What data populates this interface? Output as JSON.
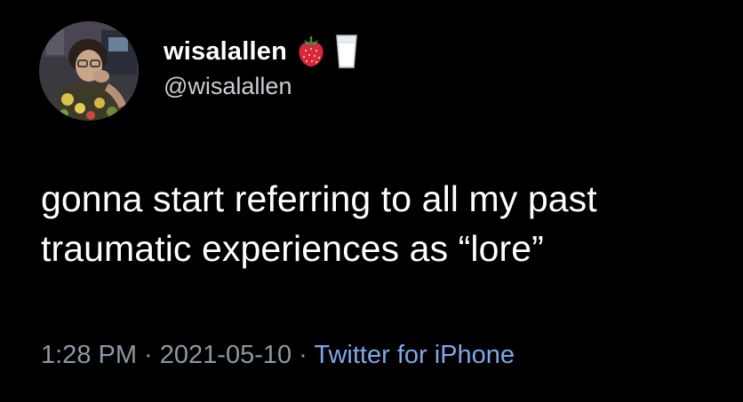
{
  "tweet": {
    "author": {
      "display_name": "wisalallen",
      "handle": "@wisalallen",
      "emojis": [
        "strawberry-emoji",
        "milk-glass-emoji"
      ]
    },
    "text_lines": [
      "gonna start referring to all my past",
      "traumatic experiences as “lore”"
    ],
    "meta": {
      "time": "1:28 PM",
      "separator": " · ",
      "date": "2021-05-10",
      "source": "Twitter for iPhone"
    }
  },
  "colors": {
    "background": "#000000",
    "text_primary": "#ffffff",
    "text_secondary": "#8b98a5",
    "link": "#7ea6e8"
  }
}
